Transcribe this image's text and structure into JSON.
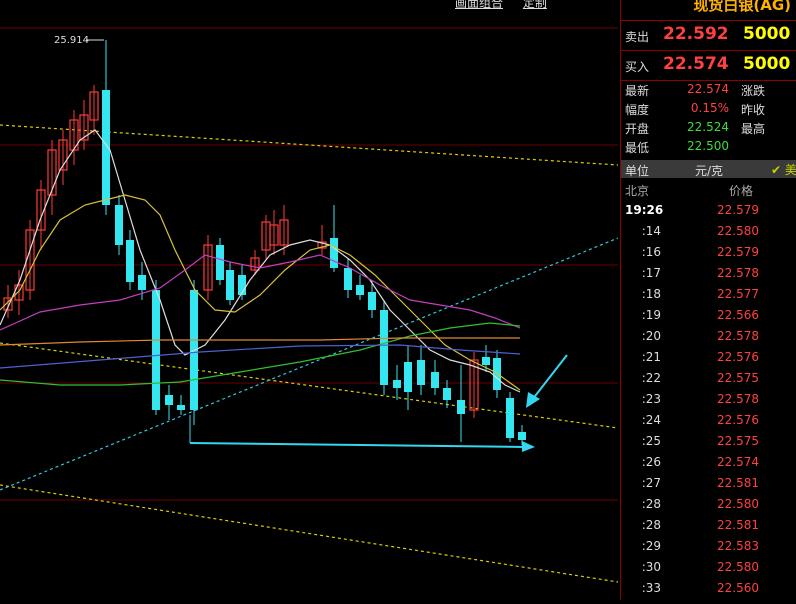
{
  "chart": {
    "high_label": "25.914",
    "links": [
      "画面组合",
      "定制"
    ]
  },
  "panel": {
    "title": "现货白银(AG)",
    "sell": {
      "label": "卖出",
      "price": "22.592",
      "volume": "5000"
    },
    "buy": {
      "label": "买入",
      "price": "22.574",
      "volume": "5000"
    },
    "stats": [
      {
        "key": "最新",
        "value": "22.574",
        "color": "#ff4040",
        "key2": "涨跌"
      },
      {
        "key": "幅度",
        "value": "0.15%",
        "color": "#ff4040",
        "key2": "昨收"
      },
      {
        "key": "开盘",
        "value": "22.524",
        "color": "#3ddc3d",
        "key2": "最高"
      },
      {
        "key": "最低",
        "value": "22.500",
        "color": "#3ddc3d",
        "key2": ""
      }
    ],
    "unit": {
      "label": "单位",
      "value": "元/克",
      "flag": "✔ 美"
    },
    "header": {
      "left": "北京",
      "right": "价格"
    },
    "ticks": [
      {
        "time": "19:26",
        "price": "22.579"
      },
      {
        "time": ":14",
        "price": "22.580"
      },
      {
        "time": ":16",
        "price": "22.579"
      },
      {
        "time": ":17",
        "price": "22.578"
      },
      {
        "time": ":18",
        "price": "22.577"
      },
      {
        "time": ":19",
        "price": "22.566"
      },
      {
        "time": ":20",
        "price": "22.578"
      },
      {
        "time": ":21",
        "price": "22.576"
      },
      {
        "time": ":22",
        "price": "22.575"
      },
      {
        "time": ":23",
        "price": "22.578"
      },
      {
        "time": ":24",
        "price": "22.576"
      },
      {
        "time": ":25",
        "price": "22.575"
      },
      {
        "time": ":26",
        "price": "22.574"
      },
      {
        "time": ":27",
        "price": "22.581"
      },
      {
        "time": ":28",
        "price": "22.580"
      },
      {
        "time": ":28",
        "price": "22.581"
      },
      {
        "time": ":29",
        "price": "22.583"
      },
      {
        "time": ":30",
        "price": "22.580"
      },
      {
        "time": ":33",
        "price": "22.560"
      }
    ]
  },
  "colors": {
    "up": "#ff3b3b",
    "down": "#33e6f0",
    "ma_white": "#dddddd",
    "ma_yellow": "#d6c23a",
    "ma_purple": "#c040c0",
    "ma_green": "#30c030",
    "ma_orange": "#e08a30",
    "ma_blue": "#5060d0",
    "trend_yellow": "#d8d000",
    "trend_cyan": "#30c8e0",
    "arrow": "#33d7f0"
  }
}
